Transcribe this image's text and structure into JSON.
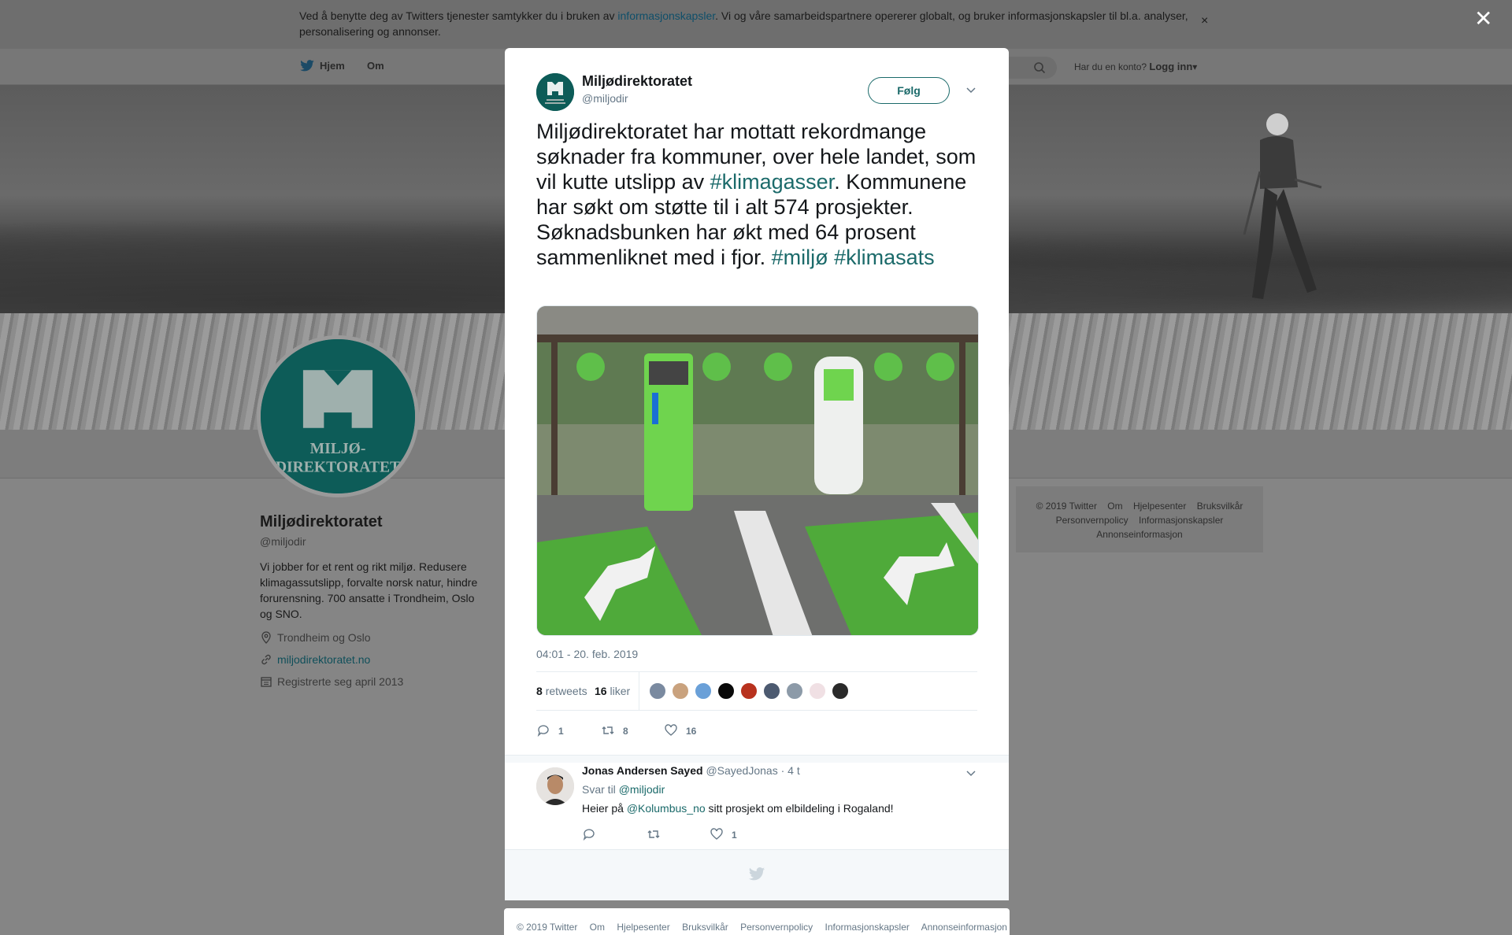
{
  "cookie": {
    "text_before": "Ved å benytte deg av Twitters tjenester samtykker du i bruken av ",
    "link": "informasjonskapsler",
    "text_after": ". Vi og våre samarbeidspartnere opererer globalt, og bruker informasjonskapsler til bl.a. analyser, personalisering og annonser.",
    "close": "×"
  },
  "overlay_close": "✕",
  "nav": {
    "home": "Hjem",
    "about": "Om",
    "account_prompt": "Har du en konto?",
    "login": "Logg inn",
    "login_caret": "▾"
  },
  "profile": {
    "name": "Miljødirektoratet",
    "handle": "@miljodir",
    "bio": "Vi jobber for et rent og rikt miljø. Redusere klimagassutslipp, forvalte norsk natur, hindre forurensning. 700 ansatte i Trondheim, Oslo og SNO.",
    "location": "Trondheim og Oslo",
    "website": "miljodirektoratet.no",
    "joined": "Registrerte seg april 2013",
    "logo_line1": "MILJØ-",
    "logo_line2": "DIREKTORATET"
  },
  "side_footer": {
    "links": [
      "© 2019 Twitter",
      "Om",
      "Hjelpesenter",
      "Bruksvilkår",
      "Personvernpolicy",
      "Informasjonskapsler",
      "Annonseinformasjon"
    ]
  },
  "tweet": {
    "author_name": "Miljødirektoratet",
    "author_handle": "@miljodir",
    "follow": "Følg",
    "text_1": "Miljødirektoratet har mottatt rekordmange søknader fra kommuner, over hele landet, som vil kutte utslipp av ",
    "hashtag_1": "#klimagasser",
    "text_2": ". Kommunene har søkt om støtte til i alt 574 prosjekter. Søknadsbunken har økt med 64 prosent sammenliknet med i fjor. ",
    "hashtag_2": "#miljø",
    "hashtag_3": "#klimasats",
    "timestamp": "04:01 - 20. feb. 2019",
    "retweets_count": "8",
    "retweets_label": "retweets",
    "likes_count": "16",
    "likes_label": "liker",
    "action_replies": "1",
    "action_retweets": "8",
    "action_likes": "16"
  },
  "reply": {
    "name": "Jonas Andersen Sayed",
    "handle": "@SayedJonas",
    "age": "· 4 t",
    "reply_to_label": "Svar til",
    "reply_to_handle": "@miljodir",
    "text_before": "Heier på ",
    "mention": "@Kolumbus_no",
    "text_after": " sitt prosjekt om elbildeling i Rogaland!",
    "likes": "1"
  },
  "bottom_footer": {
    "links": [
      "© 2019 Twitter",
      "Om",
      "Hjelpesenter",
      "Bruksvilkår",
      "Personvernpolicy",
      "Informasjonskapsler",
      "Annonseinformasjon"
    ]
  },
  "colors": {
    "accent": "#1b6a6a",
    "brand_green": "#0d5c58",
    "secondary_text": "#657786"
  }
}
